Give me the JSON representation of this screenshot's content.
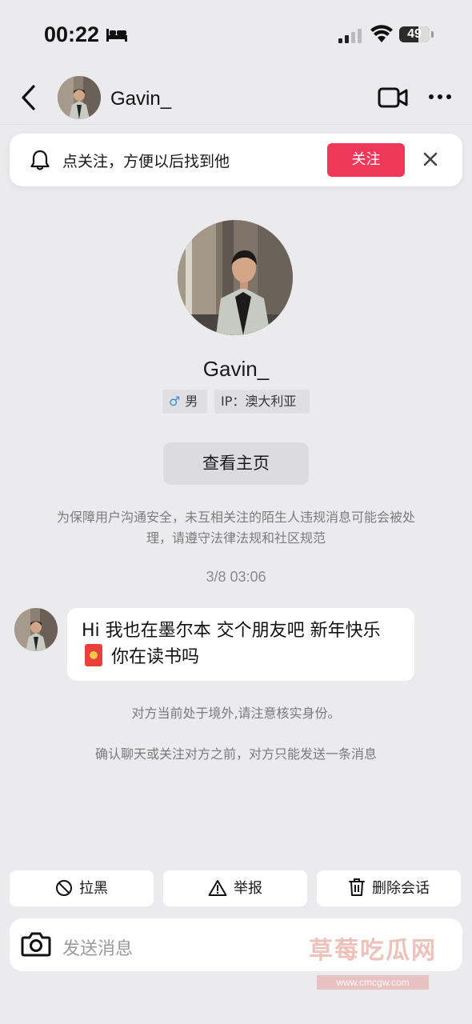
{
  "status_bar": {
    "time": "00:22",
    "battery": "49",
    "icons": [
      "bed-icon",
      "signal-icon",
      "wifi-icon",
      "battery-icon"
    ]
  },
  "header": {
    "username": "Gavin_",
    "icons": [
      "back-icon",
      "video-call-icon",
      "more-icon"
    ]
  },
  "follow_banner": {
    "text": "点关注，方便以后找到他",
    "button": "关注",
    "accent": "#f2385a"
  },
  "profile": {
    "name": "Gavin_",
    "gender_symbol": "♂",
    "gender": "男",
    "ip": "IP：澳大利亚",
    "view_profile": "查看主页"
  },
  "notice": "为保障用户沟通安全，未互相关注的陌生人违规消息可能会被处理，请遵守法律法规和社区规范",
  "timestamp": "3/8 03:06",
  "message": {
    "text_part1": "Hi 我也在墨尔本 交个朋友吧 新年快乐",
    "text_part2": " 你在读书吗",
    "emoji": "red-packet-icon"
  },
  "system_messages": [
    "对方当前处于境外,请注意核实身份。",
    "确认聊天或关注对方之前，对方只能发送一条消息"
  ],
  "actions": {
    "block": "拉黑",
    "report": "举报",
    "delete": "删除会话"
  },
  "input": {
    "placeholder": "发送消息"
  },
  "watermark": {
    "text": "草莓吃瓜网",
    "url": "www.cmcgw.com"
  }
}
